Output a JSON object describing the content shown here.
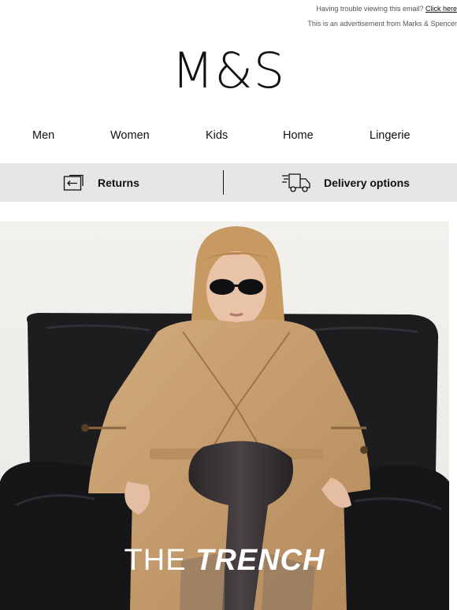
{
  "preheader": {
    "trouble_text": "Having trouble viewing this email?",
    "trouble_link": "Click here",
    "ad_text": "This is an advertisement from Marks & Spencer"
  },
  "brand": {
    "logo_text": "M&S"
  },
  "nav": {
    "items": [
      "Men",
      "Women",
      "Kids",
      "Home",
      "Lingerie"
    ]
  },
  "service_bar": {
    "returns_label": "Returns",
    "delivery_label": "Delivery options",
    "returns_icon": "returns-box-icon",
    "delivery_icon": "delivery-truck-icon"
  },
  "hero": {
    "title_light": "THE ",
    "title_bold": "TRENCH",
    "colors": {
      "coat": "#c9a273",
      "chair": "#1c1c1e",
      "background": "#f0efec"
    }
  }
}
